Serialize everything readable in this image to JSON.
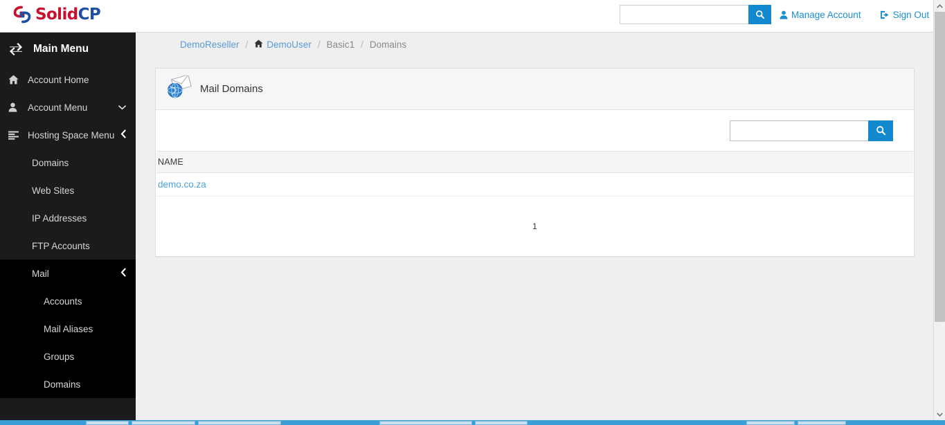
{
  "brand": {
    "name_part1": "Solid",
    "name_part2": "CP",
    "accent_blue": "#1289cd",
    "link_blue": "#4aa3df",
    "logo_red": "#c8102e",
    "logo_blue": "#1f4fa3"
  },
  "header": {
    "search": {
      "value": "",
      "placeholder": ""
    },
    "search_icon": "search-icon",
    "links": [
      {
        "label": "Manage Account",
        "icon": "user-icon"
      },
      {
        "label": "Sign Out",
        "icon": "sign-out-icon"
      }
    ]
  },
  "sidebar": {
    "title": "Main Menu",
    "title_icon": "exchange-arrows-icon",
    "items": [
      {
        "label": "Account Home",
        "icon": "home-icon",
        "level": 0,
        "caret": "",
        "active": false
      },
      {
        "label": "Account Menu",
        "icon": "user-icon",
        "level": 0,
        "caret": "chevron-down-icon",
        "active": false
      },
      {
        "label": "Hosting Space Menu",
        "icon": "list-icon",
        "level": 0,
        "caret": "chevron-left-icon",
        "active": false
      },
      {
        "label": "Domains",
        "icon": "",
        "level": 1,
        "caret": "",
        "active": false
      },
      {
        "label": "Web Sites",
        "icon": "",
        "level": 1,
        "caret": "",
        "active": false
      },
      {
        "label": "IP Addresses",
        "icon": "",
        "level": 1,
        "caret": "",
        "active": false
      },
      {
        "label": "FTP Accounts",
        "icon": "",
        "level": 1,
        "caret": "",
        "active": false
      },
      {
        "label": "Mail",
        "icon": "",
        "level": 1,
        "caret": "chevron-left-icon",
        "active": true
      },
      {
        "label": "Accounts",
        "icon": "",
        "level": 2,
        "caret": "",
        "active": false
      },
      {
        "label": "Mail Aliases",
        "icon": "",
        "level": 2,
        "caret": "",
        "active": false
      },
      {
        "label": "Groups",
        "icon": "",
        "level": 2,
        "caret": "",
        "active": false
      },
      {
        "label": "Domains",
        "icon": "",
        "level": 2,
        "caret": "",
        "active": false
      }
    ]
  },
  "breadcrumb": [
    {
      "label": "DemoReseller",
      "link": true,
      "icon": ""
    },
    {
      "label": "DemoUser",
      "link": true,
      "icon": "home-icon"
    },
    {
      "label": "Basic1",
      "link": false,
      "icon": ""
    },
    {
      "label": "Domains",
      "link": false,
      "icon": ""
    }
  ],
  "breadcrumb_separator": "/",
  "panel": {
    "title": "Mail Domains",
    "title_icon": "globe-envelope-icon",
    "search": {
      "value": "",
      "placeholder": ""
    },
    "search_icon": "search-icon",
    "table": {
      "columns": [
        "NAME"
      ],
      "rows": [
        {
          "name": "demo.co.za",
          "link": true
        }
      ]
    },
    "pagination": {
      "current": "1",
      "pages": [
        "1"
      ]
    }
  },
  "scrollbar": {
    "up_icon": "chevron-up-icon",
    "down_icon": "chevron-down-icon"
  }
}
